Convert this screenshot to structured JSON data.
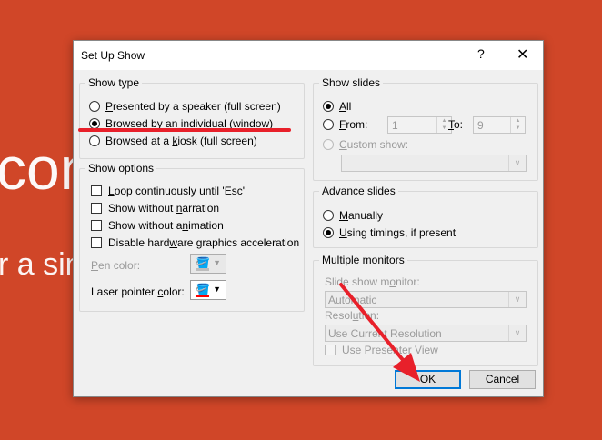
{
  "background": {
    "line1": "con",
    "line2": "r a sim"
  },
  "dialog": {
    "title": "Set Up Show",
    "help": "?",
    "close": "✕"
  },
  "show_type": {
    "label": "Show type",
    "options": [
      {
        "pre": "",
        "key": "P",
        "rest": "resented by a speaker (full screen)",
        "checked": false
      },
      {
        "pre": "",
        "key": "B",
        "rest": "rowsed by an individual (window)",
        "checked": true
      },
      {
        "pre": "Browsed at a ",
        "key": "k",
        "rest": "iosk (full screen)",
        "checked": false
      }
    ]
  },
  "show_options": {
    "label": "Show options",
    "items": [
      {
        "pre": "",
        "key": "L",
        "rest": "oop continuously until 'Esc'"
      },
      {
        "pre": "Show without ",
        "key": "n",
        "rest": "arration"
      },
      {
        "pre": "Show without a",
        "key": "n",
        "rest": "imation"
      },
      {
        "pre": "Disable hard",
        "key": "w",
        "rest": "are graphics acceleration"
      }
    ],
    "pen_color": {
      "key": "P",
      "rest": "en color:"
    },
    "laser_color": {
      "pre": "Laser pointer ",
      "key": "c",
      "rest": "olor:"
    }
  },
  "show_slides": {
    "label": "Show slides",
    "all": {
      "key": "A",
      "rest": "ll"
    },
    "from": {
      "key": "F",
      "rest": "rom:"
    },
    "from_value": "1",
    "to": {
      "key": "T",
      "rest": "o:"
    },
    "to_value": "9",
    "custom": {
      "key": "C",
      "rest": "ustom show:"
    }
  },
  "advance_slides": {
    "label": "Advance slides",
    "manually": {
      "key": "M",
      "rest": "anually"
    },
    "timings": {
      "key": "U",
      "rest": "sing timings, if present"
    }
  },
  "multiple_monitors": {
    "label": "Multiple monitors",
    "monitor_label": {
      "pre": "Slide show m",
      "key": "o",
      "rest": "nitor:"
    },
    "monitor_value": "Automatic",
    "resolution_label": {
      "pre": "Resol",
      "key": "u",
      "rest": "tion:"
    },
    "resolution_value": "Use Current Resolution",
    "presenter_view": {
      "pre": "Use Presenter ",
      "key": "V",
      "rest": "iew"
    }
  },
  "buttons": {
    "ok": "OK",
    "cancel": "Cancel"
  },
  "colors": {
    "laser_swatch": "#ff0000",
    "pen_swatch": "#bdbdbd",
    "annotation": "#e8202a",
    "accent": "#0078d7",
    "slide_bg": "#d04628"
  }
}
